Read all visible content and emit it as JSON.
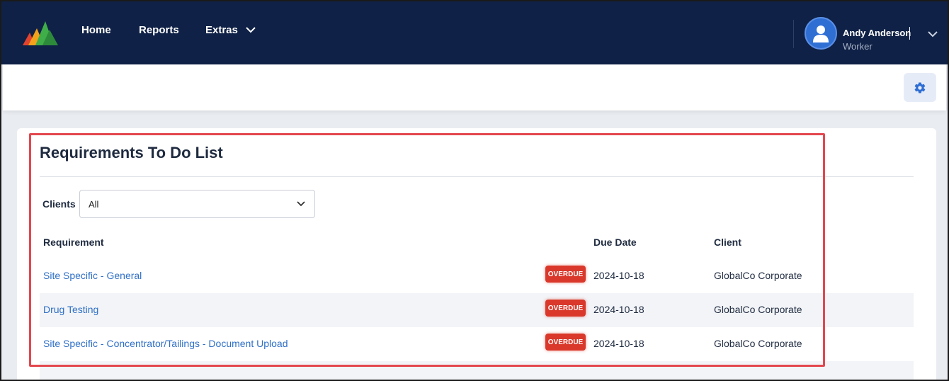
{
  "nav": {
    "links": [
      "Home",
      "Reports",
      "Extras"
    ],
    "user_name": "Andy Anderson",
    "user_role": "Worker"
  },
  "todo": {
    "title": "Requirements To Do List",
    "filter_label": "Clients",
    "filter_value": "All",
    "columns": [
      "Requirement",
      "Due Date",
      "Client"
    ],
    "rows": [
      {
        "requirement": "Site Specific - General",
        "status": "OVERDUE",
        "due": "2024-10-18",
        "client": "GlobalCo Corporate"
      },
      {
        "requirement": "Drug Testing",
        "status": "OVERDUE",
        "due": "2024-10-18",
        "client": "GlobalCo Corporate"
      },
      {
        "requirement": "Site Specific - Concentrator/Tailings - Document Upload",
        "status": "OVERDUE",
        "due": "2024-10-18",
        "client": "GlobalCo Corporate"
      }
    ]
  },
  "colors": {
    "navbar": "#0f2146",
    "link": "#2f6fc6",
    "overdue": "#d9382a",
    "highlight": "#e3474f"
  },
  "icons": [
    "app-logo",
    "chevron-down-icon",
    "user-icon",
    "gear-icon"
  ]
}
